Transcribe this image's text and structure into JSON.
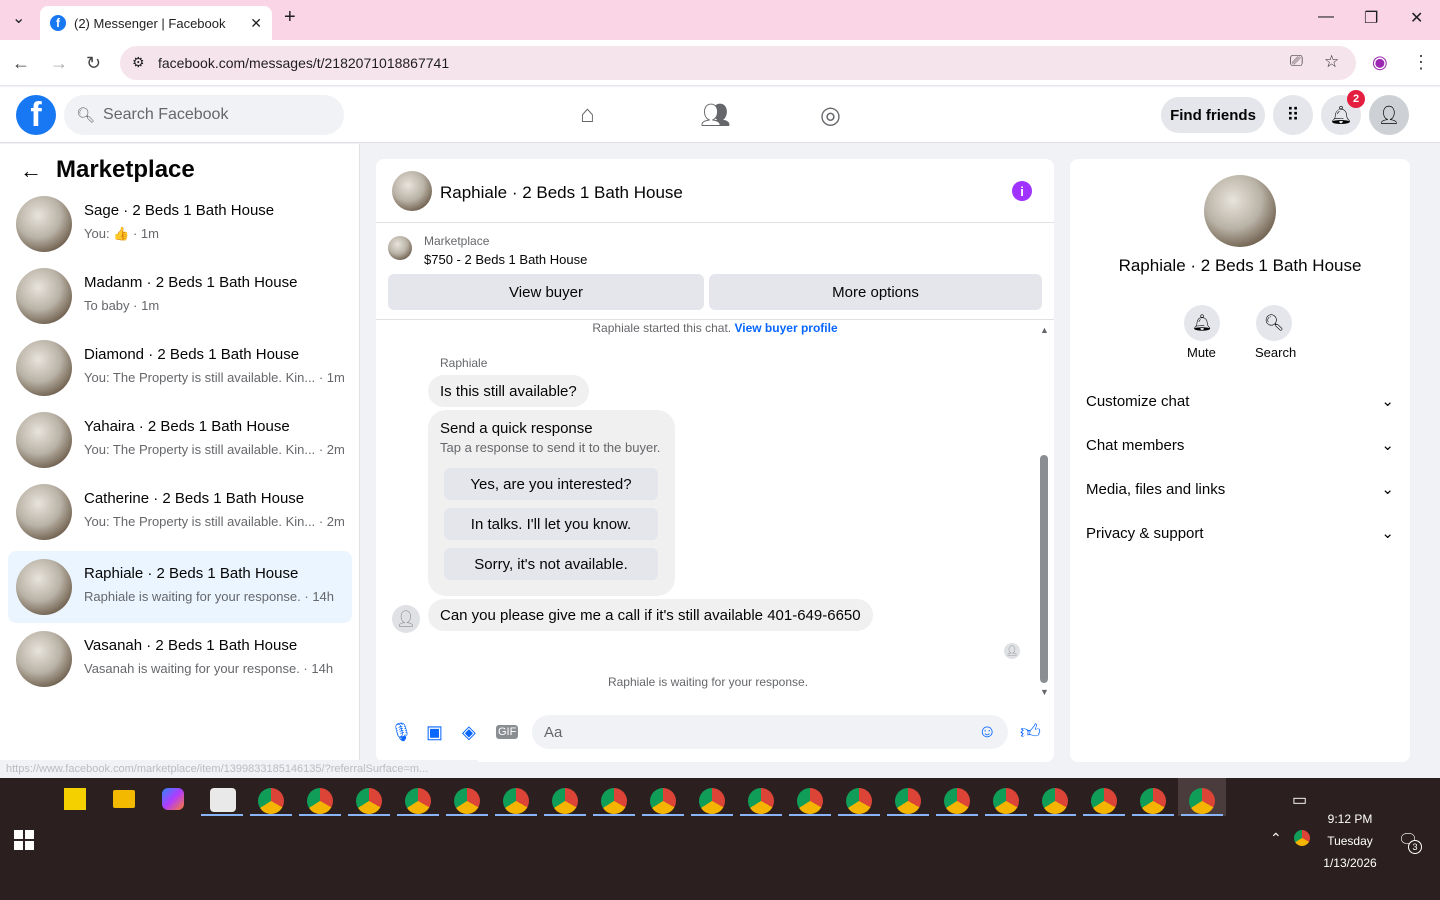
{
  "browser": {
    "tab_title": "(2) Messenger | Facebook",
    "tab_close": "✕",
    "new_tab": "+",
    "url": "facebook.com/messages/t/2182071018867741",
    "status_url": "https://www.facebook.com/marketplace/item/1399833185146135/?referralSurface=m..."
  },
  "fb_header": {
    "logo": "f",
    "search_placeholder": "Search Facebook",
    "find_friends": "Find friends",
    "notification_count": "2"
  },
  "sidebar": {
    "title": "Marketplace",
    "conversations": [
      {
        "name": "Sage · 2 Beds 1 Bath House",
        "snippet": "You: 👍 · 1m"
      },
      {
        "name": "Madanm · 2 Beds 1 Bath House",
        "snippet": "To baby · 1m"
      },
      {
        "name": "Diamond · 2 Beds 1 Bath House",
        "snippet": "You: The Property is still available. Kin... · 1m"
      },
      {
        "name": "Yahaira · 2 Beds 1 Bath House",
        "snippet": "You: The Property is still available. Kin... · 2m"
      },
      {
        "name": "Catherine · 2 Beds 1 Bath House",
        "snippet": "You: The Property is still available. Kin... · 2m"
      },
      {
        "name": "Raphiale · 2 Beds 1 Bath House",
        "snippet": "Raphiale is waiting for your response. · 14h"
      },
      {
        "name": "Vasanah · 2 Beds 1 Bath House",
        "snippet": "Vasanah is waiting for your response. · 14h"
      }
    ]
  },
  "chat": {
    "title": "Raphiale · 2 Beds 1 Bath House",
    "listing_label": "Marketplace",
    "listing_price": "$750 - 2 Beds 1 Bath House",
    "view_buyer": "View buyer",
    "more_options": "More options",
    "started_text": "Raphiale started this chat.",
    "view_buyer_profile": "View buyer profile",
    "sender_name": "Raphiale",
    "message1": "Is this still available?",
    "quick_title": "Send a quick response",
    "quick_sub": "Tap a response to send it to the buyer.",
    "quick_responses": [
      "Yes, are you interested?",
      "In talks. I'll let you know.",
      "Sorry, it's not available."
    ],
    "message2": "Can you please give me a call if it's still available 401-649-6650",
    "waiting": "Raphiale is waiting for your response.",
    "composer_placeholder": "Aa"
  },
  "details": {
    "name": "Raphiale · 2 Beds 1 Bath House",
    "mute": "Mute",
    "search": "Search",
    "sections": [
      "Customize chat",
      "Chat members",
      "Media, files and links",
      "Privacy & support"
    ]
  },
  "taskbar": {
    "time": "9:12 PM",
    "day": "Tuesday",
    "date": "1/13/2026",
    "notif_count": "3"
  },
  "colors": {
    "fb_blue": "#1877f2",
    "accent_blue": "#0866ff",
    "tab_strip": "#f9d5e6",
    "taskbar": "#2b1f1f"
  }
}
